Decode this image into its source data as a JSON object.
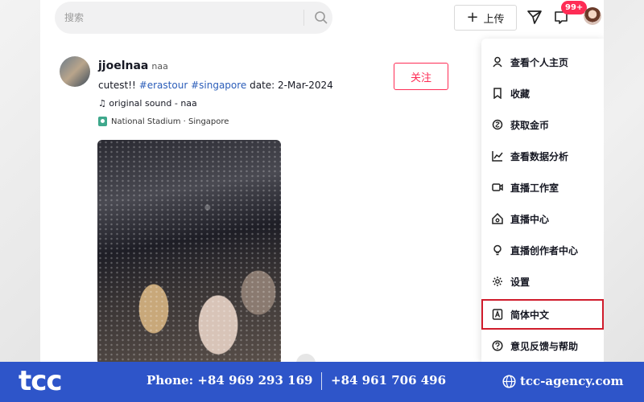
{
  "search": {
    "placeholder": "搜索"
  },
  "header": {
    "upload_label": "上传",
    "notification_badge": "99+"
  },
  "post": {
    "username": "jjoelnaa",
    "nickname": "naa",
    "caption_prefix": "cutest!! ",
    "hashtags": [
      "#erastour",
      "#singapore"
    ],
    "caption_suffix": " date: 2-Mar-2024",
    "music": "original sound - naa",
    "location": "National Stadium · Singapore",
    "follow_label": "关注"
  },
  "menu": {
    "items": [
      {
        "label": "查看个人主页",
        "icon": "person-icon"
      },
      {
        "label": "收藏",
        "icon": "bookmark-icon"
      },
      {
        "label": "获取金币",
        "icon": "coin-icon"
      },
      {
        "label": "查看数据分析",
        "icon": "analytics-icon"
      },
      {
        "label": "直播工作室",
        "icon": "live-studio-icon"
      },
      {
        "label": "直播中心",
        "icon": "live-center-icon"
      },
      {
        "label": "直播创作者中心",
        "icon": "lightbulb-icon"
      },
      {
        "label": "设置",
        "icon": "gear-icon"
      },
      {
        "label": "简体中文",
        "icon": "language-icon"
      },
      {
        "label": "意见反馈与帮助",
        "icon": "help-icon"
      }
    ],
    "highlighted_index": 8
  },
  "footer": {
    "logo": "tcc",
    "phone1": "Phone: +84 969 293 169",
    "phone2": "+84 961 706 496",
    "website": "tcc-agency.com"
  },
  "colors": {
    "accent": "#fe2c55",
    "banner": "#2e55c9",
    "highlight_box": "#d01c2c",
    "hashtag": "#2b5db9"
  }
}
